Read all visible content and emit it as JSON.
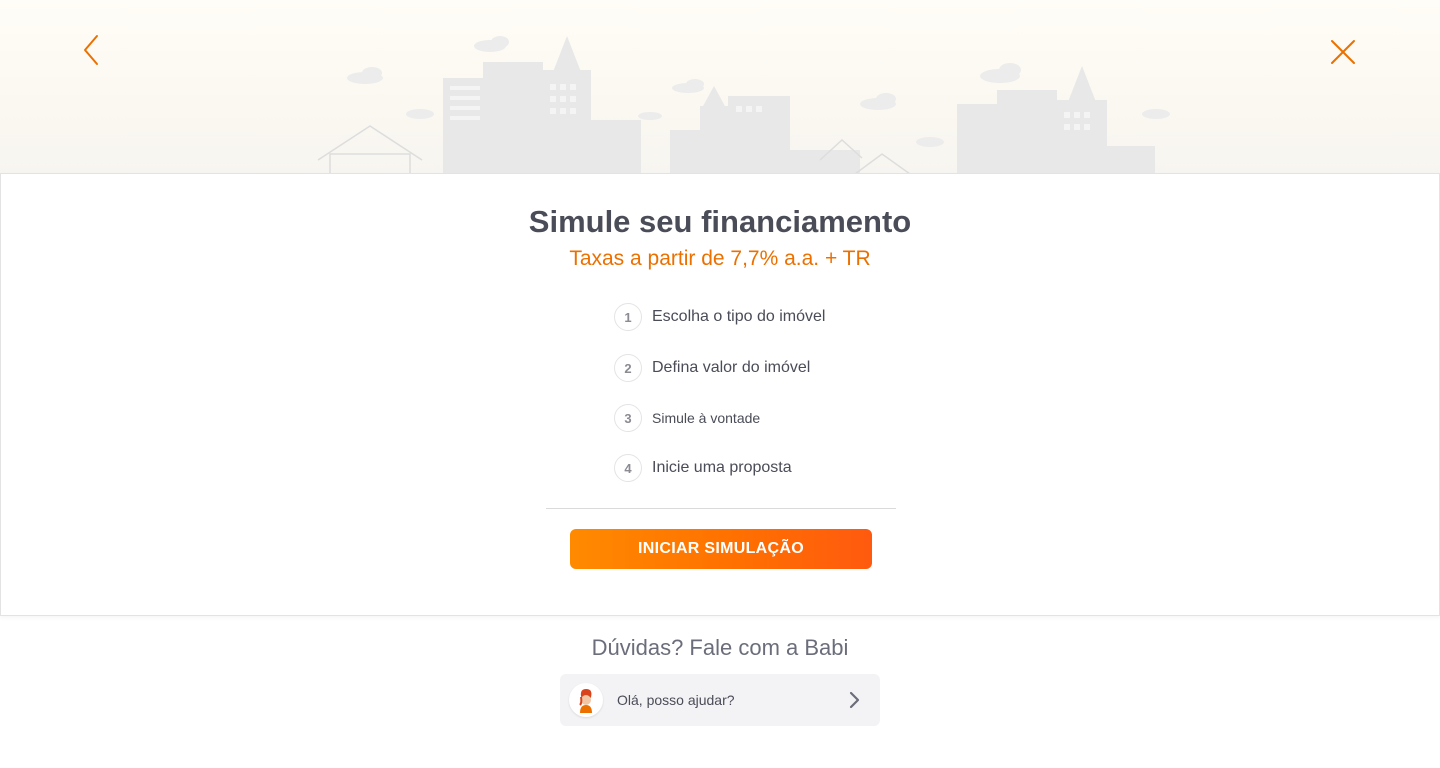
{
  "header": {
    "back_icon": "chevron-left-icon",
    "close_icon": "close-icon",
    "accent_color": "#ec7000",
    "illustration": "city-skyline-illustration"
  },
  "card": {
    "title": "Simule seu financiamento",
    "subtitle": "Taxas a partir de 7,7% a.a. + TR",
    "steps": [
      {
        "number": "1",
        "label": "Escolha o tipo do imóvel"
      },
      {
        "number": "2",
        "label": "Defina valor do imóvel"
      },
      {
        "number": "3",
        "label": "Simule à vontade"
      },
      {
        "number": "4",
        "label": "Inicie uma proposta"
      }
    ],
    "cta_label": "INICIAR SIMULAÇÃO",
    "cta_color": "#ff7000"
  },
  "help": {
    "title": "Dúvidas? Fale com a Babi",
    "chat_label": "Olá, posso ajudar?",
    "avatar_icon": "babi-avatar-icon",
    "chevron_icon": "chevron-right-icon"
  }
}
